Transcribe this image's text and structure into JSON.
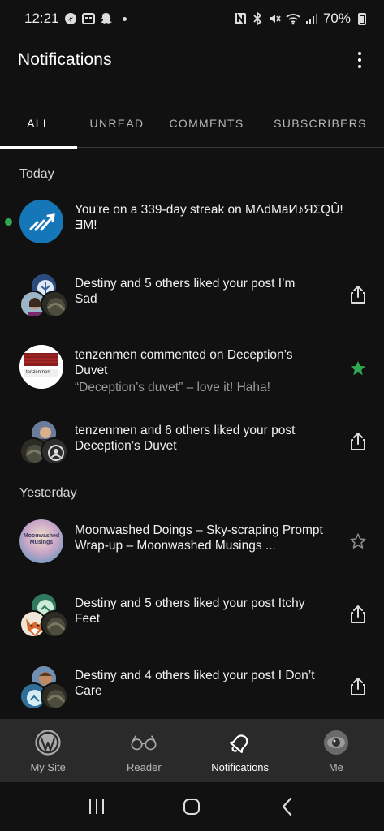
{
  "status_bar": {
    "time": "12:21",
    "battery": "70%"
  },
  "header": {
    "title": "Notifications"
  },
  "tabs": [
    {
      "label": "ALL",
      "active": true
    },
    {
      "label": "UNREAD",
      "active": false
    },
    {
      "label": "COMMENTS",
      "active": false
    },
    {
      "label": "SUBSCRIBERS",
      "active": false
    }
  ],
  "sections": {
    "today": "Today",
    "yesterday": "Yesterday"
  },
  "notifications": [
    {
      "text": "You're on a 339-day streak on MΛdMäИ♪ЯΣQÛ! ƎM!",
      "unread": true,
      "action": "none"
    },
    {
      "text": "Destiny and 5 others liked your post I’m Sad",
      "action": "share-icon"
    },
    {
      "text": "tenzenmen commented on Deception’s Duvet",
      "sub": "“Deception’s duvet” – love it! Haha!",
      "action": "star-filled-icon"
    },
    {
      "text": "tenzenmen and 6 others liked your post Deception’s Duvet",
      "action": "share-icon"
    },
    {
      "text": "Moonwashed Doings – Sky-scraping Prompt Wrap-up – Moonwashed Musings ...",
      "action": "star-outline-icon"
    },
    {
      "text": "Destiny and 5 others liked your post Itchy Feet",
      "action": "share-icon"
    },
    {
      "text": "Destiny and 4 others liked your post I Don’t Care",
      "action": "share-icon"
    }
  ],
  "avatar_labels": {
    "tenzenmen_banner": "tenzenmen",
    "moonwashed": "Moonwashed Musings"
  },
  "bottom_nav": [
    {
      "label": "My Site",
      "icon": "wordpress-icon"
    },
    {
      "label": "Reader",
      "icon": "glasses-icon"
    },
    {
      "label": "Notifications",
      "icon": "bell-icon",
      "active": true
    },
    {
      "label": "Me",
      "icon": "avatar-icon"
    }
  ],
  "colors": {
    "background": "#111111",
    "accent_green": "#2fa84f",
    "nav_bg": "#2a2a2a",
    "wordpress_blue": "#1677b8"
  }
}
